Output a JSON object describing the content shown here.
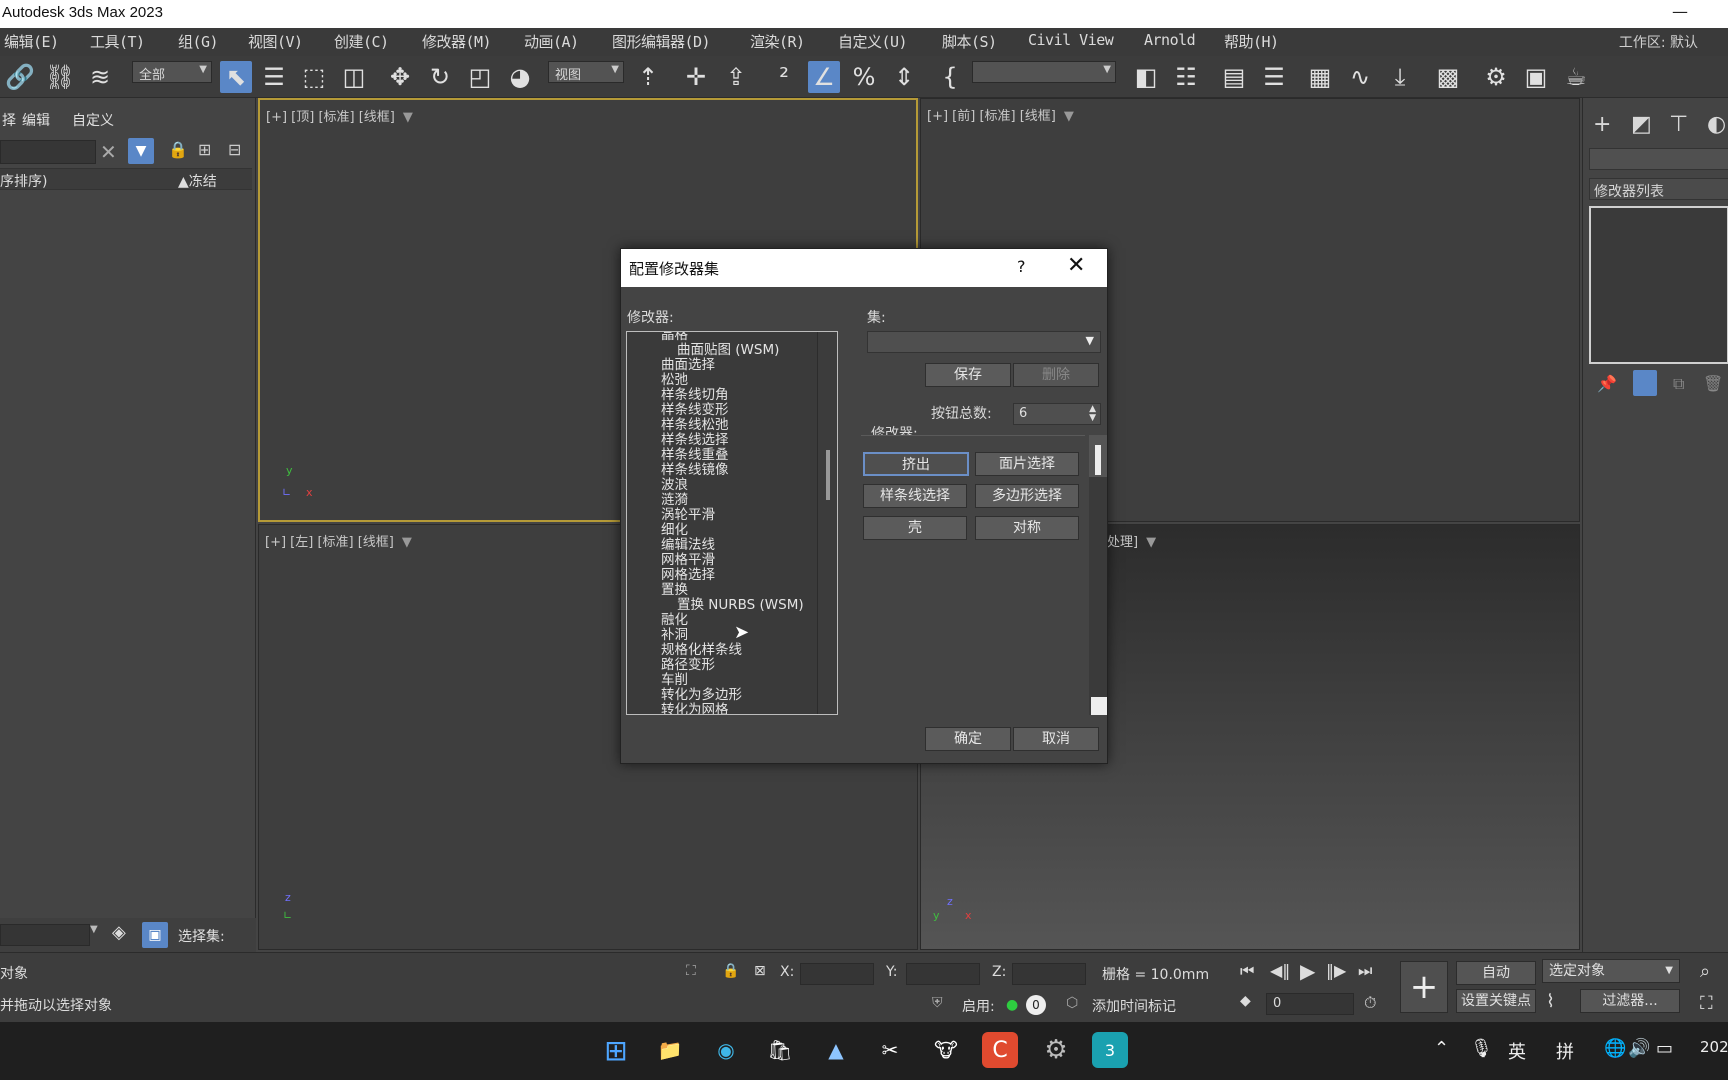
{
  "window": {
    "title": "Autodesk 3ds Max 2023",
    "minimize": "—"
  },
  "menu": {
    "items": [
      "编辑(E)",
      "工具(T)",
      "组(G)",
      "视图(V)",
      "创建(C)",
      "修改器(M)",
      "动画(A)",
      "图形编辑器(D)",
      "渲染(R)",
      "自定义(U)",
      "脚本(S)",
      "Civil View",
      "Arnold",
      "帮助(H)"
    ],
    "workspace_label": "工作区: 默认"
  },
  "toolbar": {
    "selection_filter": "全部",
    "ref_coord": "视图",
    "named_sel": "",
    "icons": [
      "link-icon",
      "unlink-icon",
      "bind-spacewarp-icon",
      "select-icon",
      "select-by-name-icon",
      "rect-region-icon",
      "window-crossing-icon",
      "move-icon",
      "rotate-icon",
      "scale-icon",
      "place-icon",
      "pivot-icon",
      "manipulate-icon",
      "keyboard-shortcut-icon",
      "snap-icon",
      "angle-snap-icon",
      "percent-snap-icon",
      "spinner-snap-icon",
      "edit-named-sel-icon",
      "mirror-icon",
      "align-icon",
      "scene-explorer-icon",
      "layer-icon",
      "ribbon-icon",
      "curve-editor-icon",
      "schematic-icon",
      "material-editor-icon",
      "render-setup-icon",
      "render-frame-icon",
      "render-icon"
    ]
  },
  "scene_explorer": {
    "tabs": [
      "编辑",
      "自定义"
    ],
    "tab_prefix": "择",
    "sort_label": "序排序)",
    "freeze_label": "▲冻结",
    "selection_set_label": "选择集:"
  },
  "viewports": {
    "top": "[+] [顶] [标准] [线框]",
    "front": "[+] [前] [标准] [线框]",
    "left": "[+] [左] [标准] [线框]",
    "persp": "处理]"
  },
  "command_panel": {
    "modifier_list": "修改器列表"
  },
  "status": {
    "line1": "对象",
    "line2": "并拖动以选择对象",
    "x_label": "X:",
    "y_label": "Y:",
    "z_label": "Z:",
    "grid": "栅格 = 10.0mm",
    "enable": "启用:",
    "add_time_tag": "添加时间标记",
    "auto": "自动",
    "sel_obj": "选定对象",
    "set_key": "设置关键点",
    "filters": "过滤器...",
    "frame": "0",
    "counter": "0"
  },
  "taskbar": {
    "tray": [
      "英",
      "拼"
    ],
    "clock": "202"
  },
  "dialog": {
    "title": "配置修改器集",
    "help": "?",
    "close": "✕",
    "modifiers_label": "修改器:",
    "set_label": "集:",
    "save": "保存",
    "delete": "删除",
    "total_buttons_label": "按钮总数:",
    "total_buttons": "6",
    "modifiers_section": "修改器:",
    "list": [
      {
        "t": "晶格",
        "i": 0
      },
      {
        "t": "曲面贴图 (WSM)",
        "i": 1
      },
      {
        "t": "曲面选择",
        "i": 0
      },
      {
        "t": "松弛",
        "i": 0
      },
      {
        "t": "样条线切角",
        "i": 0
      },
      {
        "t": "样条线变形",
        "i": 0
      },
      {
        "t": "样条线松弛",
        "i": 0
      },
      {
        "t": "样条线选择",
        "i": 0
      },
      {
        "t": "样条线重叠",
        "i": 0
      },
      {
        "t": "样条线镜像",
        "i": 0
      },
      {
        "t": "波浪",
        "i": 0
      },
      {
        "t": "涟漪",
        "i": 0
      },
      {
        "t": "涡轮平滑",
        "i": 0
      },
      {
        "t": "细化",
        "i": 0
      },
      {
        "t": "编辑法线",
        "i": 0
      },
      {
        "t": "网格平滑",
        "i": 0
      },
      {
        "t": "网格选择",
        "i": 0
      },
      {
        "t": "置换",
        "i": 0
      },
      {
        "t": "置换 NURBS (WSM)",
        "i": 1
      },
      {
        "t": "融化",
        "i": 0
      },
      {
        "t": "补洞",
        "i": 0
      },
      {
        "t": "规格化样条线",
        "i": 0
      },
      {
        "t": "路径变形",
        "i": 0
      },
      {
        "t": "车削",
        "i": 0
      },
      {
        "t": "转化为多边形",
        "i": 0
      },
      {
        "t": "转化为网格",
        "i": 0
      }
    ],
    "buttons": [
      "挤出",
      "面片选择",
      "样条线选择",
      "多边形选择",
      "壳",
      "对称"
    ],
    "ok": "确定",
    "cancel": "取消"
  }
}
